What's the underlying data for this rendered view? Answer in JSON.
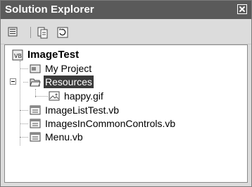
{
  "window": {
    "title": "Solution Explorer"
  },
  "toolbar": {
    "buttons": [
      {
        "name": "properties-icon"
      },
      {
        "name": "show-all-files-icon"
      },
      {
        "name": "refresh-icon"
      }
    ]
  },
  "tree": {
    "root": {
      "label": "ImageTest",
      "icon": "vb-project-icon"
    },
    "items": [
      {
        "label": "My Project",
        "icon": "my-project-icon"
      },
      {
        "label": "Resources",
        "icon": "folder-open-icon",
        "selected": true,
        "expanded": true
      },
      {
        "label": "happy.gif",
        "icon": "image-file-icon"
      },
      {
        "label": "ImageListTest.vb",
        "icon": "form-file-icon"
      },
      {
        "label": "ImagesInCommonControls.vb",
        "icon": "form-file-icon"
      },
      {
        "label": "Menu.vb",
        "icon": "form-file-icon"
      }
    ]
  }
}
